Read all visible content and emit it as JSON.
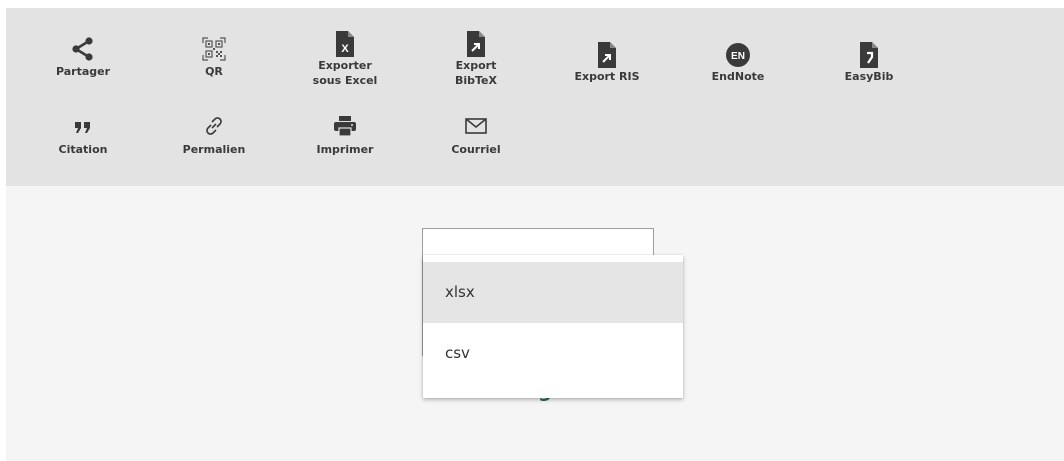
{
  "toolbar": {
    "items": [
      {
        "label": "Partager",
        "icon": "share-icon"
      },
      {
        "label": "QR",
        "icon": "qr-code-icon"
      },
      {
        "label": "Exporter\nsous Excel",
        "icon": "excel-file-icon"
      },
      {
        "label": "Export\nBibTeX",
        "icon": "bibtex-file-icon"
      },
      {
        "label": "Export RIS",
        "icon": "ris-file-icon"
      },
      {
        "label": "EndNote",
        "icon": "endnote-icon",
        "badge": "EN"
      },
      {
        "label": "EasyBib",
        "icon": "easybib-icon"
      },
      {
        "label": "Citation",
        "icon": "quote-icon"
      },
      {
        "label": "Permalien",
        "icon": "link-icon"
      },
      {
        "label": "Imprimer",
        "icon": "printer-icon"
      },
      {
        "label": "Courriel",
        "icon": "envelope-icon"
      }
    ]
  },
  "download": {
    "title": "Téléchargement",
    "options": [
      "xlsx",
      "csv"
    ],
    "highlighted": "xlsx"
  },
  "colors": {
    "toolbar_bg": "#e3e3e3",
    "page_bg": "#f5f5f5",
    "icon": "#3a3a3a",
    "title": "#2e6b4f",
    "highlight": "#e5e5e5"
  }
}
